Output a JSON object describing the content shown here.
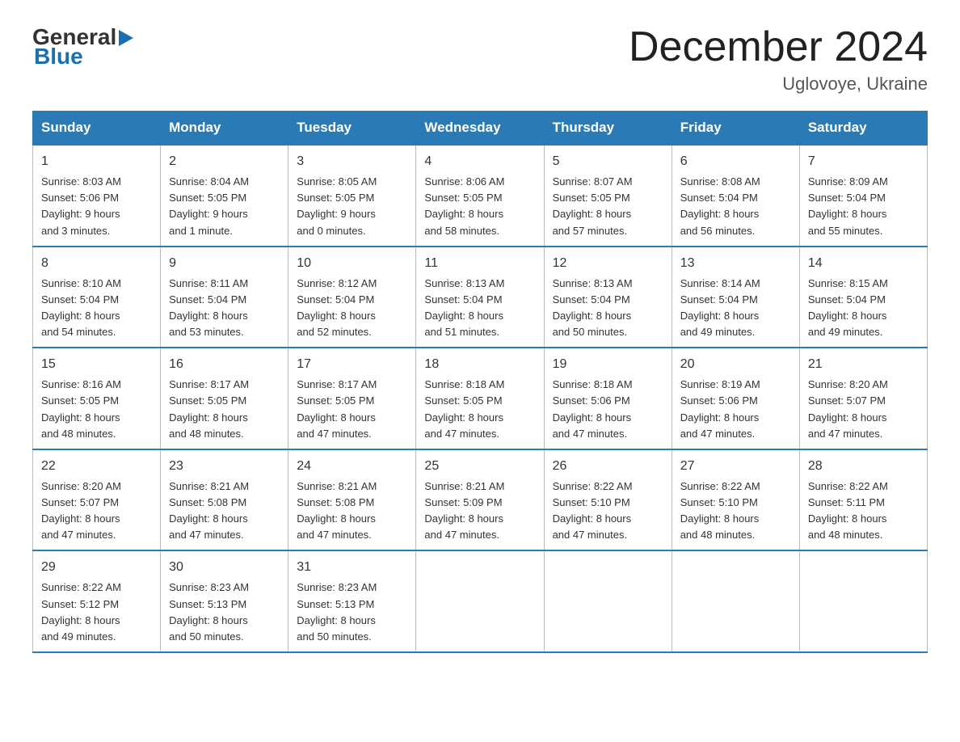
{
  "logo": {
    "general": "General",
    "blue": "Blue"
  },
  "title": "December 2024",
  "location": "Uglovoye, Ukraine",
  "weekdays": [
    "Sunday",
    "Monday",
    "Tuesday",
    "Wednesday",
    "Thursday",
    "Friday",
    "Saturday"
  ],
  "weeks": [
    [
      {
        "day": "1",
        "sunrise": "8:03 AM",
        "sunset": "5:06 PM",
        "daylight": "9 hours and 3 minutes."
      },
      {
        "day": "2",
        "sunrise": "8:04 AM",
        "sunset": "5:05 PM",
        "daylight": "9 hours and 1 minute."
      },
      {
        "day": "3",
        "sunrise": "8:05 AM",
        "sunset": "5:05 PM",
        "daylight": "9 hours and 0 minutes."
      },
      {
        "day": "4",
        "sunrise": "8:06 AM",
        "sunset": "5:05 PM",
        "daylight": "8 hours and 58 minutes."
      },
      {
        "day": "5",
        "sunrise": "8:07 AM",
        "sunset": "5:05 PM",
        "daylight": "8 hours and 57 minutes."
      },
      {
        "day": "6",
        "sunrise": "8:08 AM",
        "sunset": "5:04 PM",
        "daylight": "8 hours and 56 minutes."
      },
      {
        "day": "7",
        "sunrise": "8:09 AM",
        "sunset": "5:04 PM",
        "daylight": "8 hours and 55 minutes."
      }
    ],
    [
      {
        "day": "8",
        "sunrise": "8:10 AM",
        "sunset": "5:04 PM",
        "daylight": "8 hours and 54 minutes."
      },
      {
        "day": "9",
        "sunrise": "8:11 AM",
        "sunset": "5:04 PM",
        "daylight": "8 hours and 53 minutes."
      },
      {
        "day": "10",
        "sunrise": "8:12 AM",
        "sunset": "5:04 PM",
        "daylight": "8 hours and 52 minutes."
      },
      {
        "day": "11",
        "sunrise": "8:13 AM",
        "sunset": "5:04 PM",
        "daylight": "8 hours and 51 minutes."
      },
      {
        "day": "12",
        "sunrise": "8:13 AM",
        "sunset": "5:04 PM",
        "daylight": "8 hours and 50 minutes."
      },
      {
        "day": "13",
        "sunrise": "8:14 AM",
        "sunset": "5:04 PM",
        "daylight": "8 hours and 49 minutes."
      },
      {
        "day": "14",
        "sunrise": "8:15 AM",
        "sunset": "5:04 PM",
        "daylight": "8 hours and 49 minutes."
      }
    ],
    [
      {
        "day": "15",
        "sunrise": "8:16 AM",
        "sunset": "5:05 PM",
        "daylight": "8 hours and 48 minutes."
      },
      {
        "day": "16",
        "sunrise": "8:17 AM",
        "sunset": "5:05 PM",
        "daylight": "8 hours and 48 minutes."
      },
      {
        "day": "17",
        "sunrise": "8:17 AM",
        "sunset": "5:05 PM",
        "daylight": "8 hours and 47 minutes."
      },
      {
        "day": "18",
        "sunrise": "8:18 AM",
        "sunset": "5:05 PM",
        "daylight": "8 hours and 47 minutes."
      },
      {
        "day": "19",
        "sunrise": "8:18 AM",
        "sunset": "5:06 PM",
        "daylight": "8 hours and 47 minutes."
      },
      {
        "day": "20",
        "sunrise": "8:19 AM",
        "sunset": "5:06 PM",
        "daylight": "8 hours and 47 minutes."
      },
      {
        "day": "21",
        "sunrise": "8:20 AM",
        "sunset": "5:07 PM",
        "daylight": "8 hours and 47 minutes."
      }
    ],
    [
      {
        "day": "22",
        "sunrise": "8:20 AM",
        "sunset": "5:07 PM",
        "daylight": "8 hours and 47 minutes."
      },
      {
        "day": "23",
        "sunrise": "8:21 AM",
        "sunset": "5:08 PM",
        "daylight": "8 hours and 47 minutes."
      },
      {
        "day": "24",
        "sunrise": "8:21 AM",
        "sunset": "5:08 PM",
        "daylight": "8 hours and 47 minutes."
      },
      {
        "day": "25",
        "sunrise": "8:21 AM",
        "sunset": "5:09 PM",
        "daylight": "8 hours and 47 minutes."
      },
      {
        "day": "26",
        "sunrise": "8:22 AM",
        "sunset": "5:10 PM",
        "daylight": "8 hours and 47 minutes."
      },
      {
        "day": "27",
        "sunrise": "8:22 AM",
        "sunset": "5:10 PM",
        "daylight": "8 hours and 48 minutes."
      },
      {
        "day": "28",
        "sunrise": "8:22 AM",
        "sunset": "5:11 PM",
        "daylight": "8 hours and 48 minutes."
      }
    ],
    [
      {
        "day": "29",
        "sunrise": "8:22 AM",
        "sunset": "5:12 PM",
        "daylight": "8 hours and 49 minutes."
      },
      {
        "day": "30",
        "sunrise": "8:23 AM",
        "sunset": "5:13 PM",
        "daylight": "8 hours and 50 minutes."
      },
      {
        "day": "31",
        "sunrise": "8:23 AM",
        "sunset": "5:13 PM",
        "daylight": "8 hours and 50 minutes."
      },
      null,
      null,
      null,
      null
    ]
  ]
}
